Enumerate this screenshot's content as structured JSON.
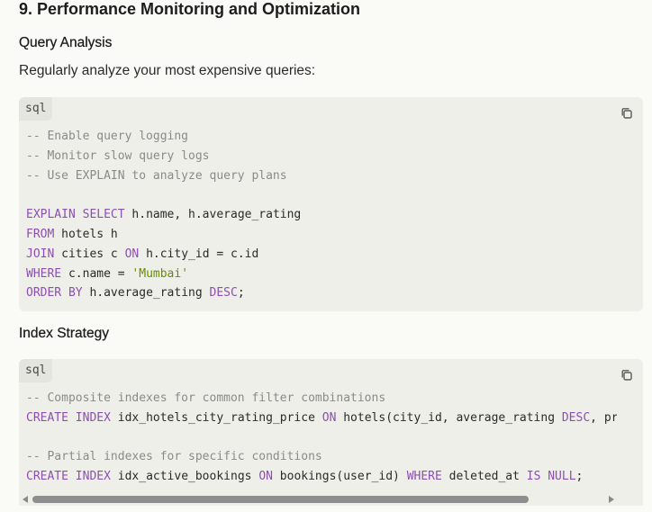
{
  "section_title": "9. Performance Monitoring and Optimization",
  "query_analysis": {
    "heading": "Query Analysis",
    "intro": "Regularly analyze your most expensive queries:",
    "code_block": {
      "language": "sql",
      "copy_icon": "copy-icon",
      "lines": [
        [
          {
            "t": "cm",
            "v": "-- Enable query logging"
          }
        ],
        [
          {
            "t": "cm",
            "v": "-- Monitor slow query logs"
          }
        ],
        [
          {
            "t": "cm",
            "v": "-- Use EXPLAIN to analyze query plans"
          }
        ],
        [],
        [
          {
            "t": "kw",
            "v": "EXPLAIN"
          },
          {
            "t": "tx",
            "v": " "
          },
          {
            "t": "kw",
            "v": "SELECT"
          },
          {
            "t": "tx",
            "v": " h.name, h.average_rating"
          }
        ],
        [
          {
            "t": "kw",
            "v": "FROM"
          },
          {
            "t": "tx",
            "v": " hotels h"
          }
        ],
        [
          {
            "t": "kw",
            "v": "JOIN"
          },
          {
            "t": "tx",
            "v": " cities c "
          },
          {
            "t": "kw",
            "v": "ON"
          },
          {
            "t": "tx",
            "v": " h.city_id = c.id"
          }
        ],
        [
          {
            "t": "kw",
            "v": "WHERE"
          },
          {
            "t": "tx",
            "v": " c.name = "
          },
          {
            "t": "st",
            "v": "'Mumbai'"
          }
        ],
        [
          {
            "t": "kw",
            "v": "ORDER BY"
          },
          {
            "t": "tx",
            "v": " h.average_rating "
          },
          {
            "t": "kw",
            "v": "DESC"
          },
          {
            "t": "tx",
            "v": ";"
          }
        ]
      ]
    }
  },
  "index_strategy": {
    "heading": "Index Strategy",
    "code_block": {
      "language": "sql",
      "copy_icon": "copy-icon",
      "lines": [
        [
          {
            "t": "cm",
            "v": "-- Composite indexes for common filter combinations"
          }
        ],
        [
          {
            "t": "kw",
            "v": "CREATE"
          },
          {
            "t": "tx",
            "v": " "
          },
          {
            "t": "kw",
            "v": "INDEX"
          },
          {
            "t": "tx",
            "v": " idx_hotels_city_rating_price "
          },
          {
            "t": "kw",
            "v": "ON"
          },
          {
            "t": "tx",
            "v": " hotels(city_id, average_rating "
          },
          {
            "t": "kw",
            "v": "DESC"
          },
          {
            "t": "tx",
            "v": ", price_per_night);"
          }
        ],
        [],
        [
          {
            "t": "cm",
            "v": "-- Partial indexes for specific conditions"
          }
        ],
        [
          {
            "t": "kw",
            "v": "CREATE"
          },
          {
            "t": "tx",
            "v": " "
          },
          {
            "t": "kw",
            "v": "INDEX"
          },
          {
            "t": "tx",
            "v": " idx_active_bookings "
          },
          {
            "t": "kw",
            "v": "ON"
          },
          {
            "t": "tx",
            "v": " bookings(user_id) "
          },
          {
            "t": "kw",
            "v": "WHERE"
          },
          {
            "t": "tx",
            "v": " deleted_at "
          },
          {
            "t": "kw",
            "v": "IS"
          },
          {
            "t": "tx",
            "v": " "
          },
          {
            "t": "kw",
            "v": "NULL"
          },
          {
            "t": "tx",
            "v": ";"
          }
        ]
      ],
      "horizontal_scroll_fraction": 0.82
    }
  },
  "colors": {
    "keyword": "#8b4fb0",
    "comment": "#8a8a8a",
    "string": "#6a8a00",
    "code_background": "#efefea",
    "page_background": "#fafaf7"
  }
}
